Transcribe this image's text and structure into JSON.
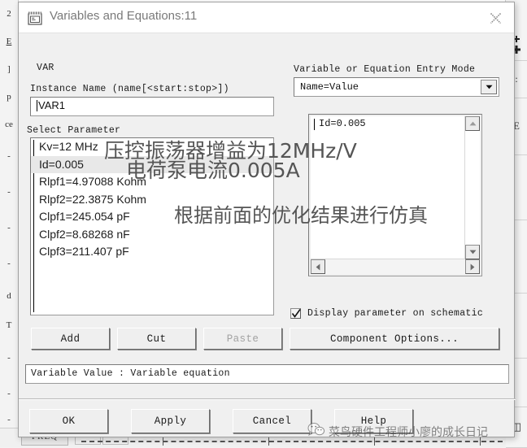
{
  "window": {
    "title": "Variables and Equations:11",
    "icon": "variables-equations-icon",
    "close_label": "×"
  },
  "form": {
    "var_group_label": "VAR",
    "instance_name_label": "Instance Name  (name[<start:stop>])",
    "instance_name_value": "VAR1",
    "select_parameter_label": "Select Parameter",
    "parameters": [
      {
        "text": "Kv=12 MHz",
        "selected": false
      },
      {
        "text": "Id=0.005",
        "selected": true
      },
      {
        "text": "Rlpf1=4.97088 Kohm",
        "selected": false
      },
      {
        "text": "Rlpf2=22.3875 Kohm",
        "selected": false
      },
      {
        "text": "Clpf1=245.054 pF",
        "selected": false
      },
      {
        "text": "Clpf2=8.68268 nF",
        "selected": false
      },
      {
        "text": "Clpf3=211.407 pF",
        "selected": false
      }
    ],
    "entry_mode_label": "Variable or Equation Entry Mode",
    "entry_mode_value": "Name=Value",
    "equation_value": "Id=0.005",
    "display_param_label": "Display parameter on schematic",
    "display_param_checked": true
  },
  "buttons": {
    "add": "Add",
    "cut": "Cut",
    "paste": "Paste",
    "paste_disabled": true,
    "component_options": "Component Options...",
    "ok": "OK",
    "apply": "Apply",
    "cancel": "Cancel",
    "help": "Help"
  },
  "statusbar": {
    "text": "Variable Value : Variable equation"
  },
  "annotations": [
    {
      "id": "annot-1",
      "text": "压控振荡器增益为12MHz/V"
    },
    {
      "id": "annot-2",
      "text": "电荷泵电流0.005A"
    },
    {
      "id": "annot-3",
      "text": "根据前面的优化结果进行仿真"
    }
  ],
  "watermark": {
    "text": "菜鸟硬件工程师小廖的成长日记"
  },
  "background": {
    "left_cells": [
      "2",
      "E",
      "]",
      "p",
      "ce",
      "-",
      "-",
      "-",
      "-",
      "d",
      "T",
      "-",
      "-",
      "-"
    ],
    "bottom_tab": "FREQ"
  },
  "colors": {
    "dialog_face": "#f0f0f0",
    "field_bg": "#ffffff",
    "selection": "#e8e8e8",
    "title_text": "#7a7a7a",
    "annotation": "#555555"
  }
}
